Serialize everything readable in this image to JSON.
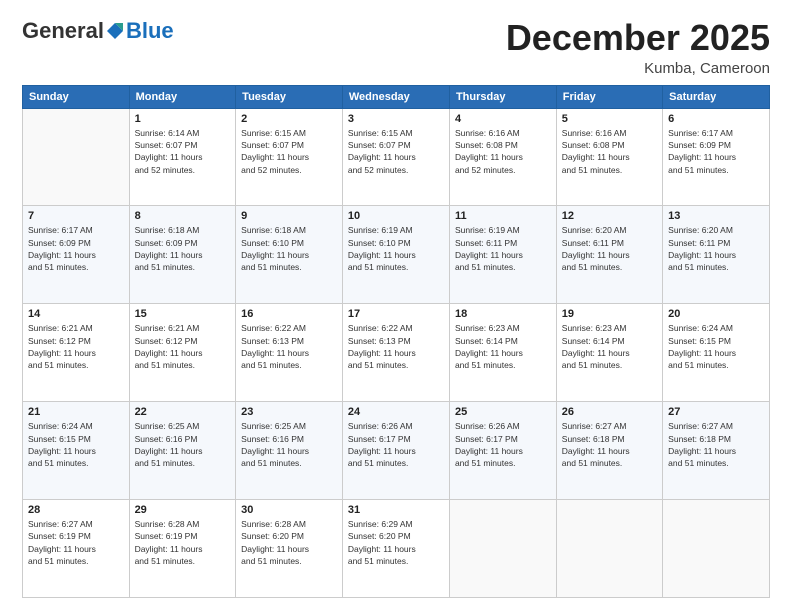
{
  "header": {
    "logo_general": "General",
    "logo_blue": "Blue",
    "month_title": "December 2025",
    "subtitle": "Kumba, Cameroon"
  },
  "weekdays": [
    "Sunday",
    "Monday",
    "Tuesday",
    "Wednesday",
    "Thursday",
    "Friday",
    "Saturday"
  ],
  "weeks": [
    [
      {
        "day": "",
        "info": ""
      },
      {
        "day": "1",
        "info": "Sunrise: 6:14 AM\nSunset: 6:07 PM\nDaylight: 11 hours\nand 52 minutes."
      },
      {
        "day": "2",
        "info": "Sunrise: 6:15 AM\nSunset: 6:07 PM\nDaylight: 11 hours\nand 52 minutes."
      },
      {
        "day": "3",
        "info": "Sunrise: 6:15 AM\nSunset: 6:07 PM\nDaylight: 11 hours\nand 52 minutes."
      },
      {
        "day": "4",
        "info": "Sunrise: 6:16 AM\nSunset: 6:08 PM\nDaylight: 11 hours\nand 52 minutes."
      },
      {
        "day": "5",
        "info": "Sunrise: 6:16 AM\nSunset: 6:08 PM\nDaylight: 11 hours\nand 51 minutes."
      },
      {
        "day": "6",
        "info": "Sunrise: 6:17 AM\nSunset: 6:09 PM\nDaylight: 11 hours\nand 51 minutes."
      }
    ],
    [
      {
        "day": "7",
        "info": "Sunrise: 6:17 AM\nSunset: 6:09 PM\nDaylight: 11 hours\nand 51 minutes."
      },
      {
        "day": "8",
        "info": "Sunrise: 6:18 AM\nSunset: 6:09 PM\nDaylight: 11 hours\nand 51 minutes."
      },
      {
        "day": "9",
        "info": "Sunrise: 6:18 AM\nSunset: 6:10 PM\nDaylight: 11 hours\nand 51 minutes."
      },
      {
        "day": "10",
        "info": "Sunrise: 6:19 AM\nSunset: 6:10 PM\nDaylight: 11 hours\nand 51 minutes."
      },
      {
        "day": "11",
        "info": "Sunrise: 6:19 AM\nSunset: 6:11 PM\nDaylight: 11 hours\nand 51 minutes."
      },
      {
        "day": "12",
        "info": "Sunrise: 6:20 AM\nSunset: 6:11 PM\nDaylight: 11 hours\nand 51 minutes."
      },
      {
        "day": "13",
        "info": "Sunrise: 6:20 AM\nSunset: 6:11 PM\nDaylight: 11 hours\nand 51 minutes."
      }
    ],
    [
      {
        "day": "14",
        "info": "Sunrise: 6:21 AM\nSunset: 6:12 PM\nDaylight: 11 hours\nand 51 minutes."
      },
      {
        "day": "15",
        "info": "Sunrise: 6:21 AM\nSunset: 6:12 PM\nDaylight: 11 hours\nand 51 minutes."
      },
      {
        "day": "16",
        "info": "Sunrise: 6:22 AM\nSunset: 6:13 PM\nDaylight: 11 hours\nand 51 minutes."
      },
      {
        "day": "17",
        "info": "Sunrise: 6:22 AM\nSunset: 6:13 PM\nDaylight: 11 hours\nand 51 minutes."
      },
      {
        "day": "18",
        "info": "Sunrise: 6:23 AM\nSunset: 6:14 PM\nDaylight: 11 hours\nand 51 minutes."
      },
      {
        "day": "19",
        "info": "Sunrise: 6:23 AM\nSunset: 6:14 PM\nDaylight: 11 hours\nand 51 minutes."
      },
      {
        "day": "20",
        "info": "Sunrise: 6:24 AM\nSunset: 6:15 PM\nDaylight: 11 hours\nand 51 minutes."
      }
    ],
    [
      {
        "day": "21",
        "info": "Sunrise: 6:24 AM\nSunset: 6:15 PM\nDaylight: 11 hours\nand 51 minutes."
      },
      {
        "day": "22",
        "info": "Sunrise: 6:25 AM\nSunset: 6:16 PM\nDaylight: 11 hours\nand 51 minutes."
      },
      {
        "day": "23",
        "info": "Sunrise: 6:25 AM\nSunset: 6:16 PM\nDaylight: 11 hours\nand 51 minutes."
      },
      {
        "day": "24",
        "info": "Sunrise: 6:26 AM\nSunset: 6:17 PM\nDaylight: 11 hours\nand 51 minutes."
      },
      {
        "day": "25",
        "info": "Sunrise: 6:26 AM\nSunset: 6:17 PM\nDaylight: 11 hours\nand 51 minutes."
      },
      {
        "day": "26",
        "info": "Sunrise: 6:27 AM\nSunset: 6:18 PM\nDaylight: 11 hours\nand 51 minutes."
      },
      {
        "day": "27",
        "info": "Sunrise: 6:27 AM\nSunset: 6:18 PM\nDaylight: 11 hours\nand 51 minutes."
      }
    ],
    [
      {
        "day": "28",
        "info": "Sunrise: 6:27 AM\nSunset: 6:19 PM\nDaylight: 11 hours\nand 51 minutes."
      },
      {
        "day": "29",
        "info": "Sunrise: 6:28 AM\nSunset: 6:19 PM\nDaylight: 11 hours\nand 51 minutes."
      },
      {
        "day": "30",
        "info": "Sunrise: 6:28 AM\nSunset: 6:20 PM\nDaylight: 11 hours\nand 51 minutes."
      },
      {
        "day": "31",
        "info": "Sunrise: 6:29 AM\nSunset: 6:20 PM\nDaylight: 11 hours\nand 51 minutes."
      },
      {
        "day": "",
        "info": ""
      },
      {
        "day": "",
        "info": ""
      },
      {
        "day": "",
        "info": ""
      }
    ]
  ]
}
